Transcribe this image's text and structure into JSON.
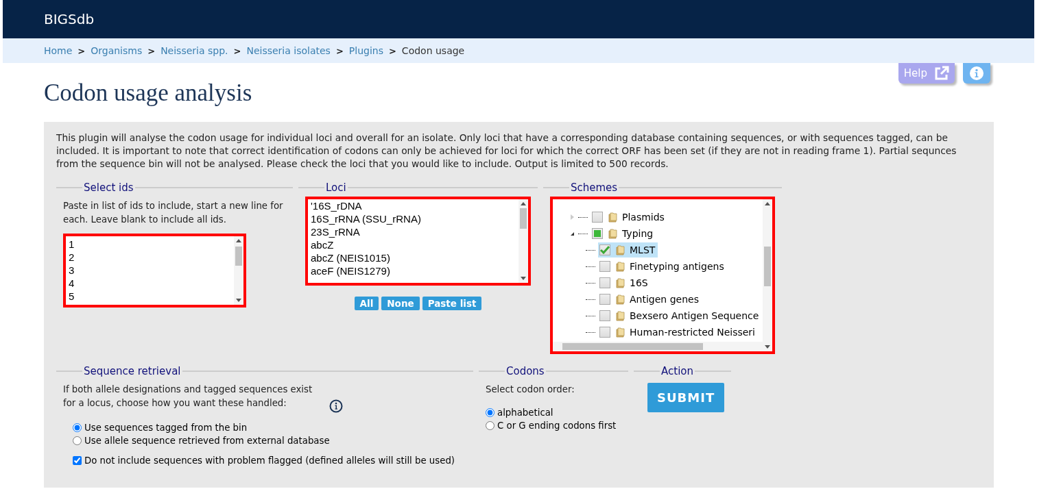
{
  "header": {
    "title": "BIGSdb"
  },
  "breadcrumb": [
    {
      "label": "Home",
      "link": true
    },
    {
      "label": "Organisms",
      "link": true
    },
    {
      "label": "Neisseria spp.",
      "link": true
    },
    {
      "label": "Neisseria isolates",
      "link": true
    },
    {
      "label": "Plugins",
      "link": true
    },
    {
      "label": "Codon usage",
      "link": false
    }
  ],
  "breadcrumb_separator": ">",
  "help_button": {
    "label": "Help"
  },
  "page_title": "Codon usage analysis",
  "intro": "This plugin will analyse the codon usage for individual loci and overall for an isolate. Only loci that have a corresponding database containing sequences, or with sequences tagged, can be included. It is important to note that correct identification of codons can only be achieved for loci for which the correct ORF has been set (if they are not in reading frame 1). Partial sequnces from the sequence bin will not be analysed. Please check the loci that you would like to include. Output is limited to 500 records.",
  "select_ids": {
    "legend": "Select ids",
    "hint": "Paste in list of ids to include, start a new line for each. Leave blank to include all ids.",
    "ids": [
      "1",
      "2",
      "3",
      "4",
      "5"
    ]
  },
  "loci": {
    "legend": "Loci",
    "items": [
      "'16S_rDNA",
      "16S_rRNA (SSU_rRNA)",
      "23S_rRNA",
      "abcZ",
      "abcZ (NEIS1015)",
      "aceF (NEIS1279)"
    ],
    "buttons": [
      "All",
      "None",
      "Paste list"
    ]
  },
  "schemes": {
    "legend": "Schemes",
    "tree": [
      {
        "label": "Plasmids",
        "checked": false,
        "partial": false,
        "selected": false,
        "expanded": false
      },
      {
        "label": "Typing",
        "checked": false,
        "partial": true,
        "selected": false,
        "expanded": true,
        "children": [
          {
            "label": "MLST",
            "checked": true,
            "selected": true
          },
          {
            "label": "Finetyping antigens",
            "checked": false,
            "selected": false
          },
          {
            "label": "16S",
            "checked": false,
            "selected": false
          },
          {
            "label": "Antigen genes",
            "checked": false,
            "selected": false
          },
          {
            "label": "Bexsero Antigen Sequence",
            "checked": false,
            "selected": false
          },
          {
            "label": "Human-restricted Neisseri",
            "checked": false,
            "selected": false
          }
        ]
      }
    ]
  },
  "sequence_retrieval": {
    "legend": "Sequence retrieval",
    "text": "If both allele designations and tagged sequences exist for a locus, choose how you want these handled:",
    "options": [
      {
        "label": "Use sequences tagged from the bin",
        "selected": true
      },
      {
        "label": "Use allele sequence retrieved from external database",
        "selected": false
      }
    ],
    "exclude_flagged": {
      "label": "Do not include sequences with problem flagged (defined alleles will still be used)",
      "checked": true
    }
  },
  "codons": {
    "legend": "Codons",
    "label": "Select codon order:",
    "options": [
      {
        "label": "alphabetical",
        "selected": true
      },
      {
        "label": "C or G ending codons first",
        "selected": false
      }
    ]
  },
  "action": {
    "legend": "Action",
    "button": "SUBMIT"
  }
}
